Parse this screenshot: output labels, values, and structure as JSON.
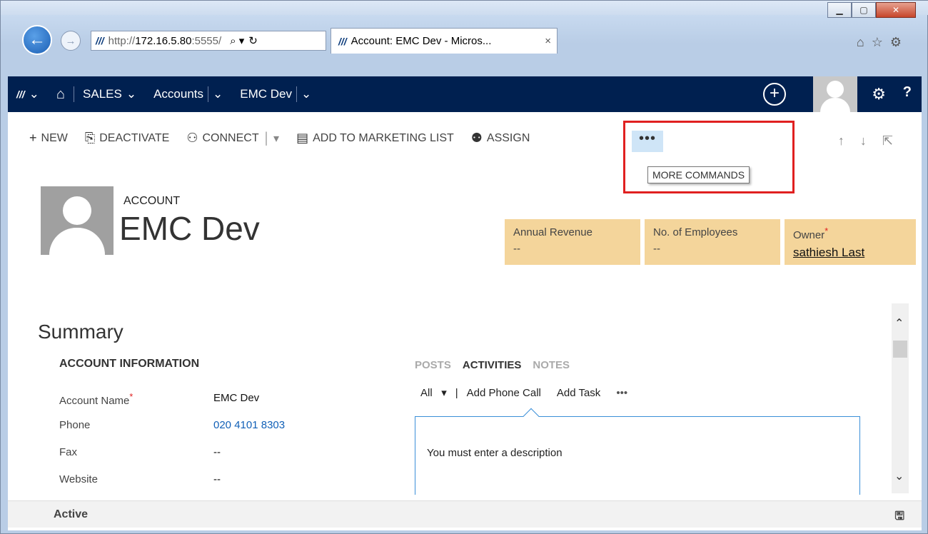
{
  "browser": {
    "address": {
      "scheme": "http://",
      "host": "172.16.5.80",
      "port": ":5555/"
    },
    "tab_title": "Account: EMC Dev - Micros...",
    "tab_close": "×"
  },
  "nav": {
    "home_icon": "home-icon",
    "module": "SALES",
    "entity": "Accounts",
    "record": "EMC Dev",
    "new_icon": "plus-circle-icon",
    "help": "?"
  },
  "commands": {
    "new": "NEW",
    "deactivate": "DEACTIVATE",
    "connect": "CONNECT",
    "add_to_marketing_list": "ADD TO MARKETING LIST",
    "assign": "ASSIGN",
    "more": "•••",
    "more_tooltip": "MORE COMMANDS"
  },
  "header": {
    "entity_type": "ACCOUNT",
    "name": "EMC Dev"
  },
  "tiles": [
    {
      "label": "Annual Revenue",
      "value": "--"
    },
    {
      "label": "No. of Employees",
      "value": "--"
    },
    {
      "label": "Owner",
      "value": "sathiesh Last"
    }
  ],
  "summary": {
    "title": "Summary",
    "section": "ACCOUNT INFORMATION",
    "fields": [
      {
        "label": "Account Name",
        "value": "EMC Dev"
      },
      {
        "label": "Phone",
        "value": "020 4101 8303"
      },
      {
        "label": "Fax",
        "value": "--"
      },
      {
        "label": "Website",
        "value": "--"
      }
    ]
  },
  "social": {
    "tabs": [
      "POSTS",
      "ACTIVITIES",
      "NOTES"
    ],
    "filter": "All",
    "add_phone_call": "Add Phone Call",
    "add_task": "Add Task",
    "more": "•••",
    "description": "You must enter a description"
  },
  "status": {
    "text": "Active"
  },
  "colors": {
    "nav_bg": "#002050",
    "tile_bg": "#f4d59b",
    "highlight": "#e02020",
    "link": "#1160b7"
  }
}
